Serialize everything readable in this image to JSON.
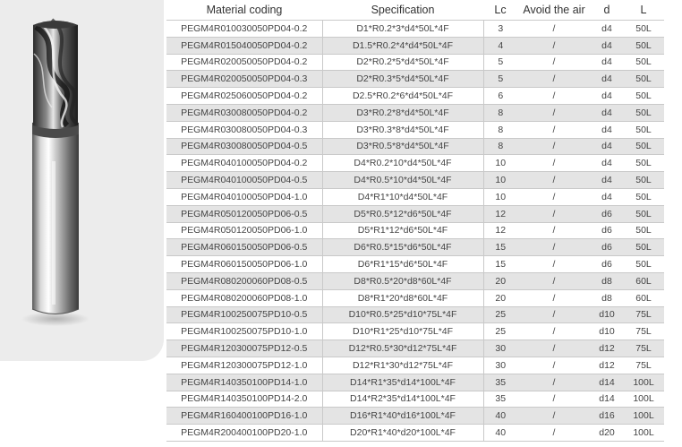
{
  "table": {
    "headers": [
      "Material coding",
      "Specification",
      "Lc",
      "Avoid the air",
      "d",
      "L"
    ],
    "rows": [
      [
        "PEGM4R010030050PD04-0.2",
        "D1*R0.2*3*d4*50L*4F",
        "3",
        "/",
        "d4",
        "50L"
      ],
      [
        "PEGM4R015040050PD04-0.2",
        "D1.5*R0.2*4*d4*50L*4F",
        "4",
        "/",
        "d4",
        "50L"
      ],
      [
        "PEGM4R020050050PD04-0.2",
        "D2*R0.2*5*d4*50L*4F",
        "5",
        "/",
        "d4",
        "50L"
      ],
      [
        "PEGM4R020050050PD04-0.3",
        "D2*R0.3*5*d4*50L*4F",
        "5",
        "/",
        "d4",
        "50L"
      ],
      [
        "PEGM4R025060050PD04-0.2",
        "D2.5*R0.2*6*d4*50L*4F",
        "6",
        "/",
        "d4",
        "50L"
      ],
      [
        "PEGM4R030080050PD04-0.2",
        "D3*R0.2*8*d4*50L*4F",
        "8",
        "/",
        "d4",
        "50L"
      ],
      [
        "PEGM4R030080050PD04-0.3",
        "D3*R0.3*8*d4*50L*4F",
        "8",
        "/",
        "d4",
        "50L"
      ],
      [
        "PEGM4R030080050PD04-0.5",
        "D3*R0.5*8*d4*50L*4F",
        "8",
        "/",
        "d4",
        "50L"
      ],
      [
        "PEGM4R040100050PD04-0.2",
        "D4*R0.2*10*d4*50L*4F",
        "10",
        "/",
        "d4",
        "50L"
      ],
      [
        "PEGM4R040100050PD04-0.5",
        "D4*R0.5*10*d4*50L*4F",
        "10",
        "/",
        "d4",
        "50L"
      ],
      [
        "PEGM4R040100050PD04-1.0",
        "D4*R1*10*d4*50L*4F",
        "10",
        "/",
        "d4",
        "50L"
      ],
      [
        "PEGM4R050120050PD06-0.5",
        "D5*R0.5*12*d6*50L*4F",
        "12",
        "/",
        "d6",
        "50L"
      ],
      [
        "PEGM4R050120050PD06-1.0",
        "D5*R1*12*d6*50L*4F",
        "12",
        "/",
        "d6",
        "50L"
      ],
      [
        "PEGM4R060150050PD06-0.5",
        "D6*R0.5*15*d6*50L*4F",
        "15",
        "/",
        "d6",
        "50L"
      ],
      [
        "PEGM4R060150050PD06-1.0",
        "D6*R1*15*d6*50L*4F",
        "15",
        "/",
        "d6",
        "50L"
      ],
      [
        "PEGM4R080200060PD08-0.5",
        "D8*R0.5*20*d8*60L*4F",
        "20",
        "/",
        "d8",
        "60L"
      ],
      [
        "PEGM4R080200060PD08-1.0",
        "D8*R1*20*d8*60L*4F",
        "20",
        "/",
        "d8",
        "60L"
      ],
      [
        "PEGM4R100250075PD10-0.5",
        "D10*R0.5*25*d10*75L*4F",
        "25",
        "/",
        "d10",
        "75L"
      ],
      [
        "PEGM4R100250075PD10-1.0",
        "D10*R1*25*d10*75L*4F",
        "25",
        "/",
        "d10",
        "75L"
      ],
      [
        "PEGM4R120300075PD12-0.5",
        "D12*R0.5*30*d12*75L*4F",
        "30",
        "/",
        "d12",
        "75L"
      ],
      [
        "PEGM4R120300075PD12-1.0",
        "D12*R1*30*d12*75L*4F",
        "30",
        "/",
        "d12",
        "75L"
      ],
      [
        "PEGM4R140350100PD14-1.0",
        "D14*R1*35*d14*100L*4F",
        "35",
        "/",
        "d14",
        "100L"
      ],
      [
        "PEGM4R140350100PD14-2.0",
        "D14*R2*35*d14*100L*4F",
        "35",
        "/",
        "d14",
        "100L"
      ],
      [
        "PEGM4R160400100PD16-1.0",
        "D16*R1*40*d16*100L*4F",
        "40",
        "/",
        "d16",
        "100L"
      ],
      [
        "PEGM4R200400100PD20-1.0",
        "D20*R1*40*d20*100L*4F",
        "40",
        "/",
        "d20",
        "100L"
      ]
    ]
  }
}
